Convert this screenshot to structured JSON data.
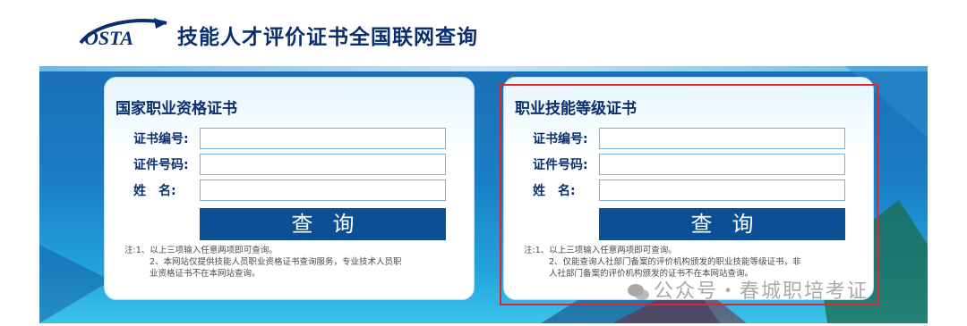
{
  "header": {
    "logo_text": "OSTA",
    "title": "技能人才评价证书全国联网查询"
  },
  "left_panel": {
    "title": "国家职业资格证书",
    "fields": [
      {
        "label": "证书编号:",
        "value": "",
        "placeholder": ""
      },
      {
        "label": "证件号码:",
        "value": "",
        "placeholder": ""
      },
      {
        "label": "姓　名:",
        "value": "",
        "placeholder": ""
      }
    ],
    "button": "查询",
    "note": [
      "注:1、以上三项输入任意两项即可查询。",
      "2、本网站仅提供技能人员职业资格证书查询服务，专业技术人员职",
      "业资格证书不在本网站查询。"
    ]
  },
  "right_panel": {
    "title": "职业技能等级证书",
    "fields": [
      {
        "label": "证书编号:",
        "value": "",
        "placeholder": ""
      },
      {
        "label": "证件号码:",
        "value": "",
        "placeholder": ""
      },
      {
        "label": "姓　名:",
        "value": "",
        "placeholder": ""
      }
    ],
    "button": "查询",
    "note": [
      "注:1、以上三项输入任意两项即可查询。",
      "2、仅能查询人社部门备案的评价机构颁发的职业技能等级证书，非",
      "人社部门备案的评价机构颁发的证书不在本网站查询。"
    ]
  },
  "watermark": "公众号・春城职培考证",
  "colors": {
    "brand_navy": "#0b2f6e",
    "button_blue": "#0b4f94",
    "banner_blue": "#1a7ec7",
    "highlight_red": "#e2252c"
  }
}
